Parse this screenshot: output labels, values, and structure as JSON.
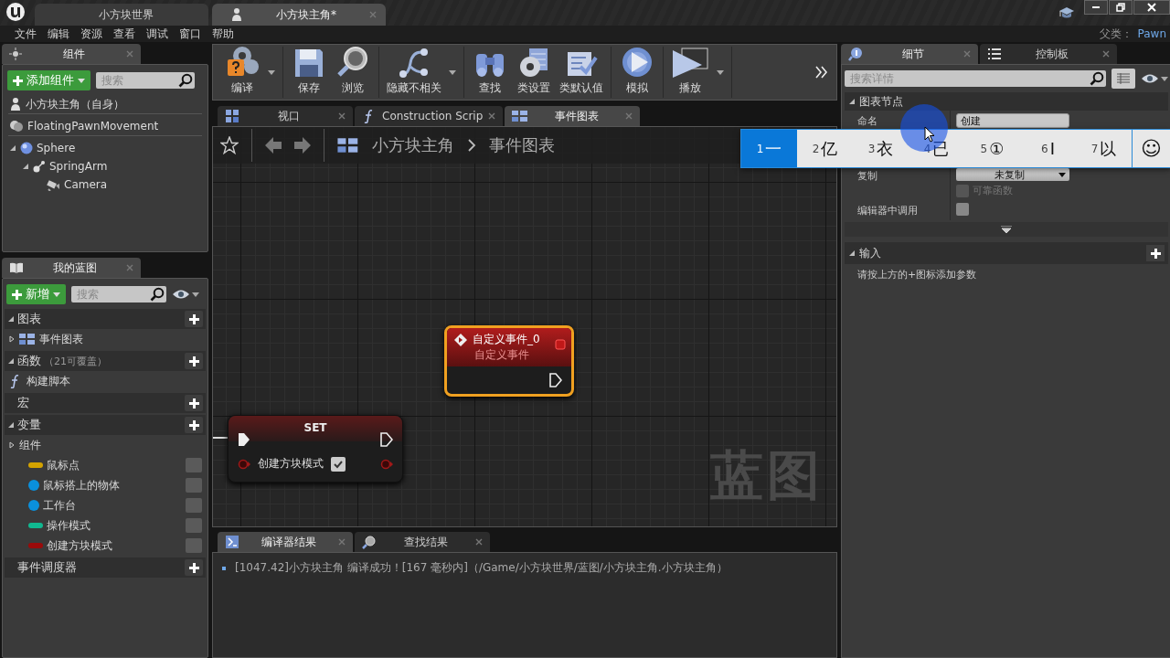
{
  "title_bar": {
    "tabs": [
      {
        "label": "小方块世界",
        "selected": false
      },
      {
        "label": "小方块主角*",
        "selected": true
      }
    ]
  },
  "menu_bar": {
    "items": [
      "文件",
      "编辑",
      "资源",
      "查看",
      "调试",
      "窗口",
      "帮助"
    ],
    "parent_label": "父类：",
    "parent_class": "Pawn"
  },
  "components_panel": {
    "tab": "组件",
    "add_button": "添加组件",
    "search": {
      "placeholder": "搜索"
    },
    "tree": [
      {
        "label": "小方块主角（自身）",
        "kind": "self"
      },
      {
        "label": "FloatingPawnMovement",
        "kind": "movement"
      },
      {
        "label": "Sphere",
        "kind": "sphere",
        "expanded": true,
        "children": [
          {
            "label": "SpringArm",
            "kind": "springarm",
            "expanded": true,
            "children": [
              {
                "label": "Camera",
                "kind": "camera"
              }
            ]
          }
        ]
      }
    ]
  },
  "my_blueprint": {
    "tab": "我的蓝图",
    "new_button": "新增",
    "search": {
      "placeholder": "搜索"
    },
    "sections": [
      {
        "title": "图表",
        "expanded": true,
        "items": [
          {
            "label": "事件图表",
            "kind": "graph",
            "expanded": false
          }
        ]
      },
      {
        "title": "函数",
        "note": "（21可覆盖）",
        "expanded": true,
        "items": [
          {
            "label": "构建脚本",
            "kind": "function"
          }
        ]
      },
      {
        "title": "宏"
      },
      {
        "title": "变量",
        "expanded": true,
        "items": [
          {
            "label": "组件",
            "kind": "category",
            "expanded": false
          },
          {
            "label": "鼠标点",
            "kind": "pill",
            "color": "#d4a300"
          },
          {
            "label": "鼠标搭上的物体",
            "kind": "ball",
            "color": "#0a90dc"
          },
          {
            "label": "工作台",
            "kind": "ball",
            "color": "#0a90dc"
          },
          {
            "label": "操作模式",
            "kind": "pill",
            "color": "#10b890"
          },
          {
            "label": "创建方块模式",
            "kind": "pill",
            "color": "#9a0a0a"
          }
        ]
      },
      {
        "title": "事件调度器"
      }
    ]
  },
  "toolbar": {
    "buttons": [
      {
        "label": "编译",
        "kind": "compile",
        "dropdown": true
      },
      {
        "label": "保存",
        "kind": "save",
        "dropdown": false
      },
      {
        "label": "浏览",
        "kind": "browse",
        "dropdown": false
      },
      {
        "label": "隐藏不相关",
        "kind": "hide",
        "dropdown": true
      },
      {
        "label": "查找",
        "kind": "find",
        "dropdown": false
      },
      {
        "label": "类设置",
        "kind": "settings",
        "dropdown": false
      },
      {
        "label": "类默认值",
        "kind": "defaults",
        "dropdown": false
      },
      {
        "label": "模拟",
        "kind": "simulate",
        "dropdown": false
      },
      {
        "label": "播放",
        "kind": "play",
        "dropdown": true
      }
    ]
  },
  "doc_tabs": [
    {
      "label": "视口",
      "kind": "viewport",
      "selected": false
    },
    {
      "label": "Construction Scrip",
      "kind": "function",
      "selected": false
    },
    {
      "label": "事件图表",
      "kind": "graph",
      "selected": true
    }
  ],
  "graph": {
    "breadcrumb": [
      "小方块主角",
      "事件图表"
    ],
    "nodes": [
      {
        "kind": "event",
        "title": "自定义事件_0",
        "subtitle": "自定义事件",
        "selected": true
      },
      {
        "kind": "set",
        "title": "SET",
        "pin": "创建方块模式",
        "checked": true,
        "selected": false
      }
    ],
    "watermark": "蓝图"
  },
  "results": {
    "tabs": [
      {
        "label": "编译器结果",
        "kind": "compiler",
        "selected": true
      },
      {
        "label": "查找结果",
        "kind": "find",
        "selected": false
      }
    ],
    "messages": [
      "[1047.42]小方块主角 编译成功！[167 毫秒内]（/Game/小方块世界/蓝图/小方块主角.小方块主角）"
    ]
  },
  "details": {
    "tabs": [
      {
        "label": "细节",
        "kind": "details",
        "selected": true
      },
      {
        "label": "控制板",
        "kind": "palette",
        "selected": false
      }
    ],
    "search": {
      "placeholder": "搜索详情"
    },
    "category": {
      "title": "图表节点",
      "expanded": true
    },
    "rows": [
      {
        "kind": "text",
        "label": "命名",
        "value": "创建"
      },
      {
        "kind": "dropdown",
        "label": "复制",
        "value": "未复制",
        "option": {
          "label": "可靠函数",
          "checked": false,
          "disabled": true
        }
      },
      {
        "kind": "checkbox",
        "label": "编辑器中调用",
        "checked": false
      }
    ],
    "inputs": {
      "title": "输入",
      "expanded": true,
      "hint": "请按上方的+图标添加参数"
    }
  },
  "ime": {
    "candidates": [
      {
        "index": "1",
        "text": "一",
        "selected": true
      },
      {
        "index": "2",
        "text": "亿",
        "selected": false
      },
      {
        "index": "3",
        "text": "衣",
        "selected": false
      },
      {
        "index": "4",
        "text": "已",
        "selected": false
      },
      {
        "index": "5",
        "text": "①",
        "selected": false
      },
      {
        "index": "6",
        "text": "I",
        "selected": false
      },
      {
        "index": "7",
        "text": "以",
        "selected": false
      }
    ],
    "emoji": "☺"
  }
}
